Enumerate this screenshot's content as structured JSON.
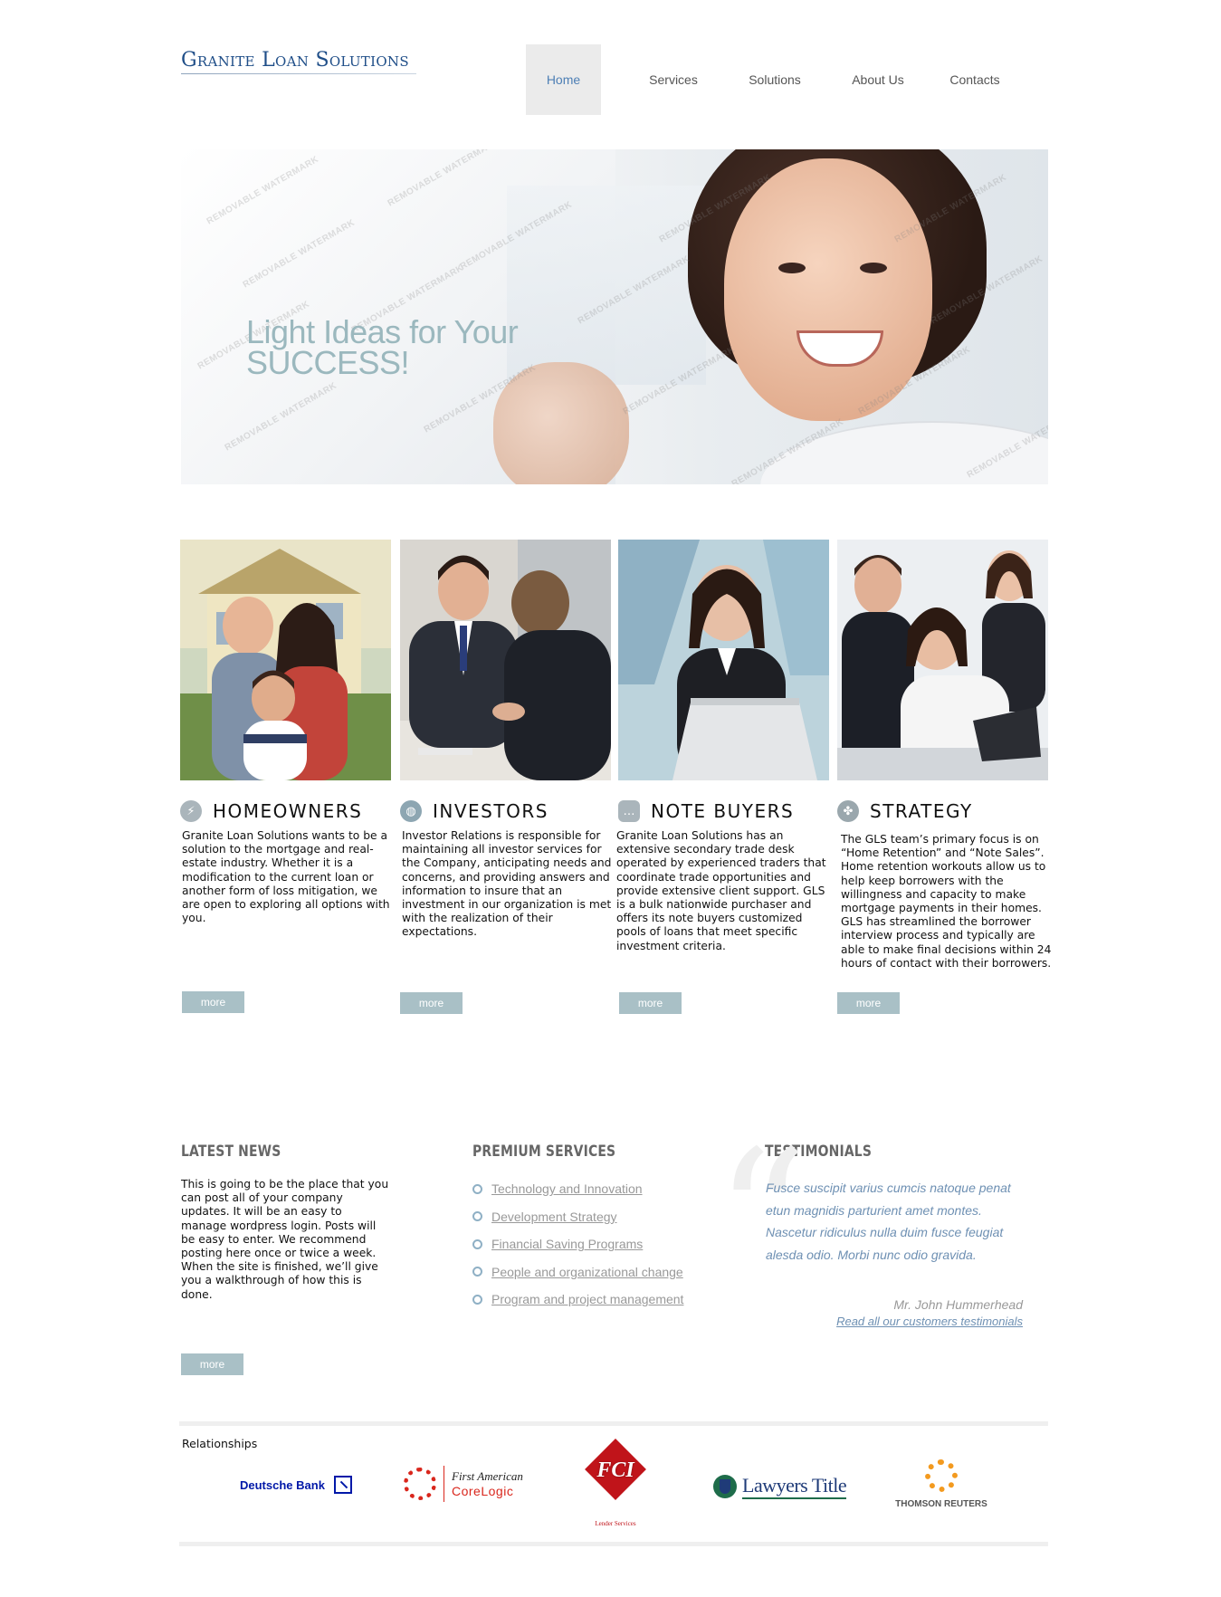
{
  "header": {
    "logo_text": "Granite Loan Solutions",
    "nav": [
      {
        "label": "Home",
        "active": true
      },
      {
        "label": "Services",
        "active": false
      },
      {
        "label": "Solutions",
        "active": false
      },
      {
        "label": "About Us",
        "active": false
      },
      {
        "label": "Contacts",
        "active": false
      }
    ]
  },
  "hero": {
    "title_line1": "Light Ideas for Your",
    "title_line2": "SUCCESS!",
    "watermark": "REMOVABLE WATERMARK"
  },
  "features": [
    {
      "icon": "lightning-icon",
      "title": "HOMEOWNERS",
      "text": "Granite Loan Solutions wants to be a solution to the mortgage and real-estate industry. Whether it is a modification to the current loan or another form of loss mitigation, we are open to exploring all options with you.",
      "more_label": "more"
    },
    {
      "icon": "globe-icon",
      "title": "INVESTORS",
      "text": "Investor Relations is responsible for maintaining all investor services for the Company, anticipating needs and concerns, and providing answers and information to insure that an investment in our organization is met with the realization of their expectations.",
      "more_label": "more"
    },
    {
      "icon": "chat-icon",
      "title": "NOTE BUYERS",
      "text": "Granite Loan Solutions has an extensive secondary trade desk operated by experienced traders that coordinate trade opportunities and provide extensive client support. GLS is a bulk nationwide purchaser and offers its note buyers customized pools of loans that meet specific investment criteria.",
      "more_label": "more"
    },
    {
      "icon": "clover-icon",
      "title": "STRATEGY",
      "text": "The GLS team’s primary focus is on “Home Retention” and “Note Sales”. Home retention workouts allow us to help keep borrowers with the willingness and capacity to make mortgage payments in their homes. GLS has streamlined the borrower interview process and typically are able to make final decisions within 24 hours of contact with their borrowers.",
      "more_label": "more"
    }
  ],
  "news": {
    "title": "LATEST NEWS",
    "text": "This is going to be the place that you can post all of your company updates. It will be an easy to manage wordpress login. Posts will be easy to enter. We recommend posting here once or twice a week. When the site is finished, we’ll give you a walkthrough of how this is done.",
    "more_label": "more"
  },
  "services": {
    "title": "PREMIUM SERVICES",
    "items": [
      "Technology and Innovation",
      "Development Strategy",
      "Financial Saving Programs",
      "People and organizational change",
      "Program and project management"
    ]
  },
  "testimonials": {
    "title": "TESTIMONIALS",
    "quote": "Fusce suscipit varius cumcis natoque penat etun magnidis parturient amet montes. Nascetur ridiculus nulla duim fusce feugiat alesda odio. Morbi nunc odio gravida.",
    "author": "Mr. John Hummerhead",
    "link_label": "Read all our customers testimonials"
  },
  "relationships": {
    "title": "Relationships",
    "partners": [
      {
        "name": "Deutsche Bank"
      },
      {
        "name_top": "First American",
        "name_bottom": "CoreLogic"
      },
      {
        "name": "FCI",
        "sub": "Lender Services"
      },
      {
        "name": "Lawyers Title"
      },
      {
        "name": "THOMSON REUTERS"
      }
    ]
  },
  "colors": {
    "accent_blue": "#4d7fb5",
    "logo_blue": "#1f4e88",
    "button_bg": "#a9c0c6",
    "testimonial_blue": "#6e90b3",
    "deutsche_blue": "#0018a8",
    "fci_red": "#c0141a",
    "thomson_orange": "#f39a1f"
  }
}
